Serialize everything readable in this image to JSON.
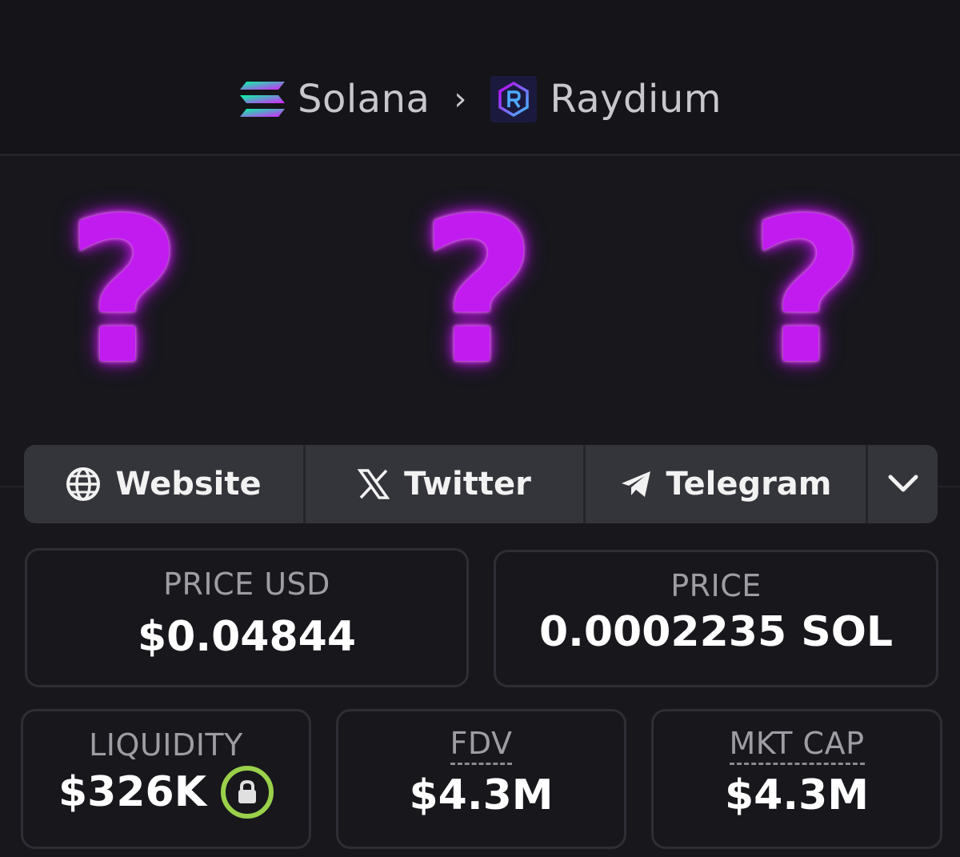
{
  "breadcrumb": {
    "chain": "Solana",
    "separator": "›",
    "dex": "Raydium",
    "chain_icon": "solana-icon",
    "dex_icon": "raydium-icon"
  },
  "placeholders": {
    "glyph": "?",
    "count": 3,
    "color": "#c21bf0"
  },
  "links": {
    "website": {
      "label": "Website",
      "icon": "globe-icon"
    },
    "twitter": {
      "label": "Twitter",
      "icon": "x-icon"
    },
    "telegram": {
      "label": "Telegram",
      "icon": "telegram-icon"
    },
    "more_icon": "chevron-down-icon"
  },
  "stats": {
    "price_usd": {
      "label": "PRICE USD",
      "value": "$0.04844"
    },
    "price_native": {
      "label": "PRICE",
      "value": "0.0002235 SOL"
    },
    "liquidity": {
      "label": "LIQUIDITY",
      "value": "$326K",
      "lock_color": "#9ad04a"
    },
    "fdv": {
      "label": "FDV",
      "value": "$4.3M"
    },
    "mkt_cap": {
      "label": "MKT CAP",
      "value": "$4.3M"
    }
  }
}
